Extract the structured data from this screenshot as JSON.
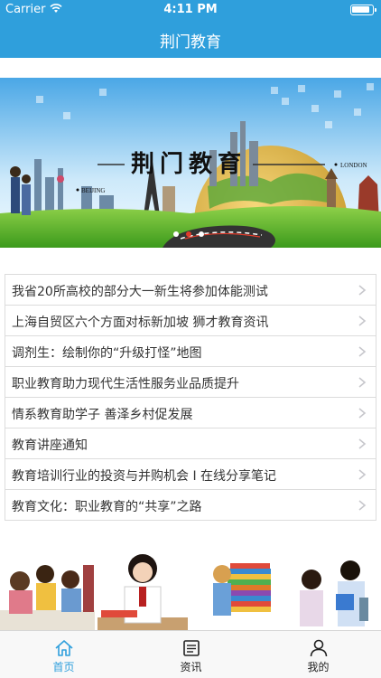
{
  "status_bar": {
    "carrier": "Carrier",
    "time": "4:11 PM"
  },
  "nav": {
    "title": "荆门教育"
  },
  "banner": {
    "headline": "荆门教育",
    "city_left": "BEIJING",
    "city_right": "LONDON"
  },
  "news": [
    {
      "title": "我省20所高校的部分大一新生将参加体能测试"
    },
    {
      "title": "上海自贸区六个方面对标新加坡 狮才教育资讯"
    },
    {
      "title": "调剂生：绘制你的“升级打怪”地图"
    },
    {
      "title": "职业教育助力现代生活性服务业品质提升"
    },
    {
      "title": "情系教育助学子 善泽乡村促发展"
    },
    {
      "title": "教育讲座通知"
    },
    {
      "title": "教育培训行业的投资与并购机会 I 在线分享笔记"
    },
    {
      "title": "教育文化：职业教育的“共享”之路"
    }
  ],
  "tabs": [
    {
      "label": "首页",
      "icon": "home-icon",
      "active": true
    },
    {
      "label": "资讯",
      "icon": "news-icon",
      "active": false
    },
    {
      "label": "我的",
      "icon": "profile-icon",
      "active": false
    }
  ],
  "colors": {
    "accent": "#2f9fdc",
    "tab_active": "#2f9fdc"
  }
}
